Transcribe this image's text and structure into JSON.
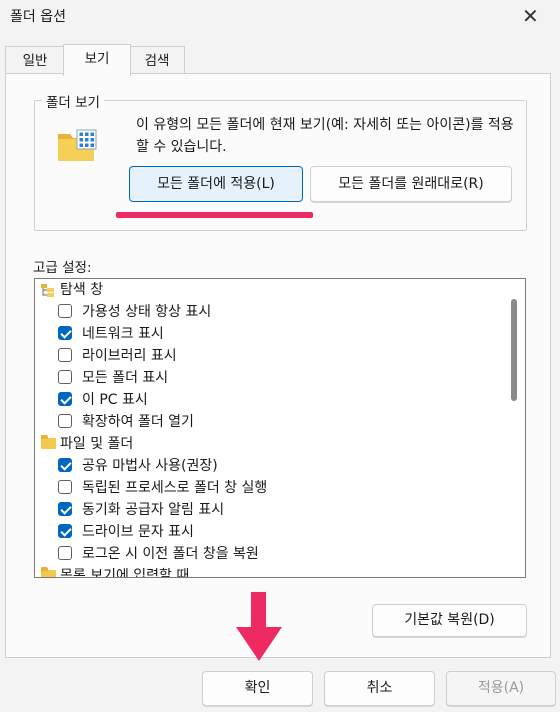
{
  "window": {
    "title": "폴더 옵션",
    "close_glyph": "✕"
  },
  "tabs": [
    {
      "label": "일반",
      "active": false
    },
    {
      "label": "보기",
      "active": true
    },
    {
      "label": "검색",
      "active": false
    }
  ],
  "folder_view": {
    "group_label": "폴더 보기",
    "icon": "folder-view-icon",
    "description": "이 유형의 모든 폴더에 현재 보기(예: 자세히 또는 아이콘)를 적용할 수 있습니다.",
    "apply_button": "모든 폴더에 적용(L)",
    "reset_button": "모든 폴더를 원래대로(R)"
  },
  "advanced": {
    "label": "고급 설정:",
    "items": [
      {
        "type": "category",
        "label": "탐색 창",
        "icon": "navigation-pane-icon"
      },
      {
        "type": "checkbox",
        "label": "가용성 상태 항상 표시",
        "checked": false
      },
      {
        "type": "checkbox",
        "label": "네트워크 표시",
        "checked": true
      },
      {
        "type": "checkbox",
        "label": "라이브러리 표시",
        "checked": false
      },
      {
        "type": "checkbox",
        "label": "모든 폴더 표시",
        "checked": false
      },
      {
        "type": "checkbox",
        "label": "이 PC 표시",
        "checked": true
      },
      {
        "type": "checkbox",
        "label": "확장하여 폴더 열기",
        "checked": false
      },
      {
        "type": "category",
        "label": "파일 및 폴더",
        "icon": "folder-icon"
      },
      {
        "type": "checkbox",
        "label": "공유 마법사 사용(권장)",
        "checked": true
      },
      {
        "type": "checkbox",
        "label": "독립된 프로세스로 폴더 창 실행",
        "checked": false
      },
      {
        "type": "checkbox",
        "label": "동기화 공급자 알림 표시",
        "checked": true
      },
      {
        "type": "checkbox",
        "label": "드라이브 문자 표시",
        "checked": true
      },
      {
        "type": "checkbox",
        "label": "로그온 시 이전 폴더 창을 복원",
        "checked": false
      },
      {
        "type": "category",
        "label": "목록 보기에 입력할 때",
        "icon": "folder-icon"
      }
    ],
    "restore_button": "기본값 복원(D)"
  },
  "footer": {
    "ok": "확인",
    "cancel": "취소",
    "apply": "적용(A)"
  },
  "colors": {
    "accent": "#0067c0",
    "annotation": "#ee2a63"
  }
}
